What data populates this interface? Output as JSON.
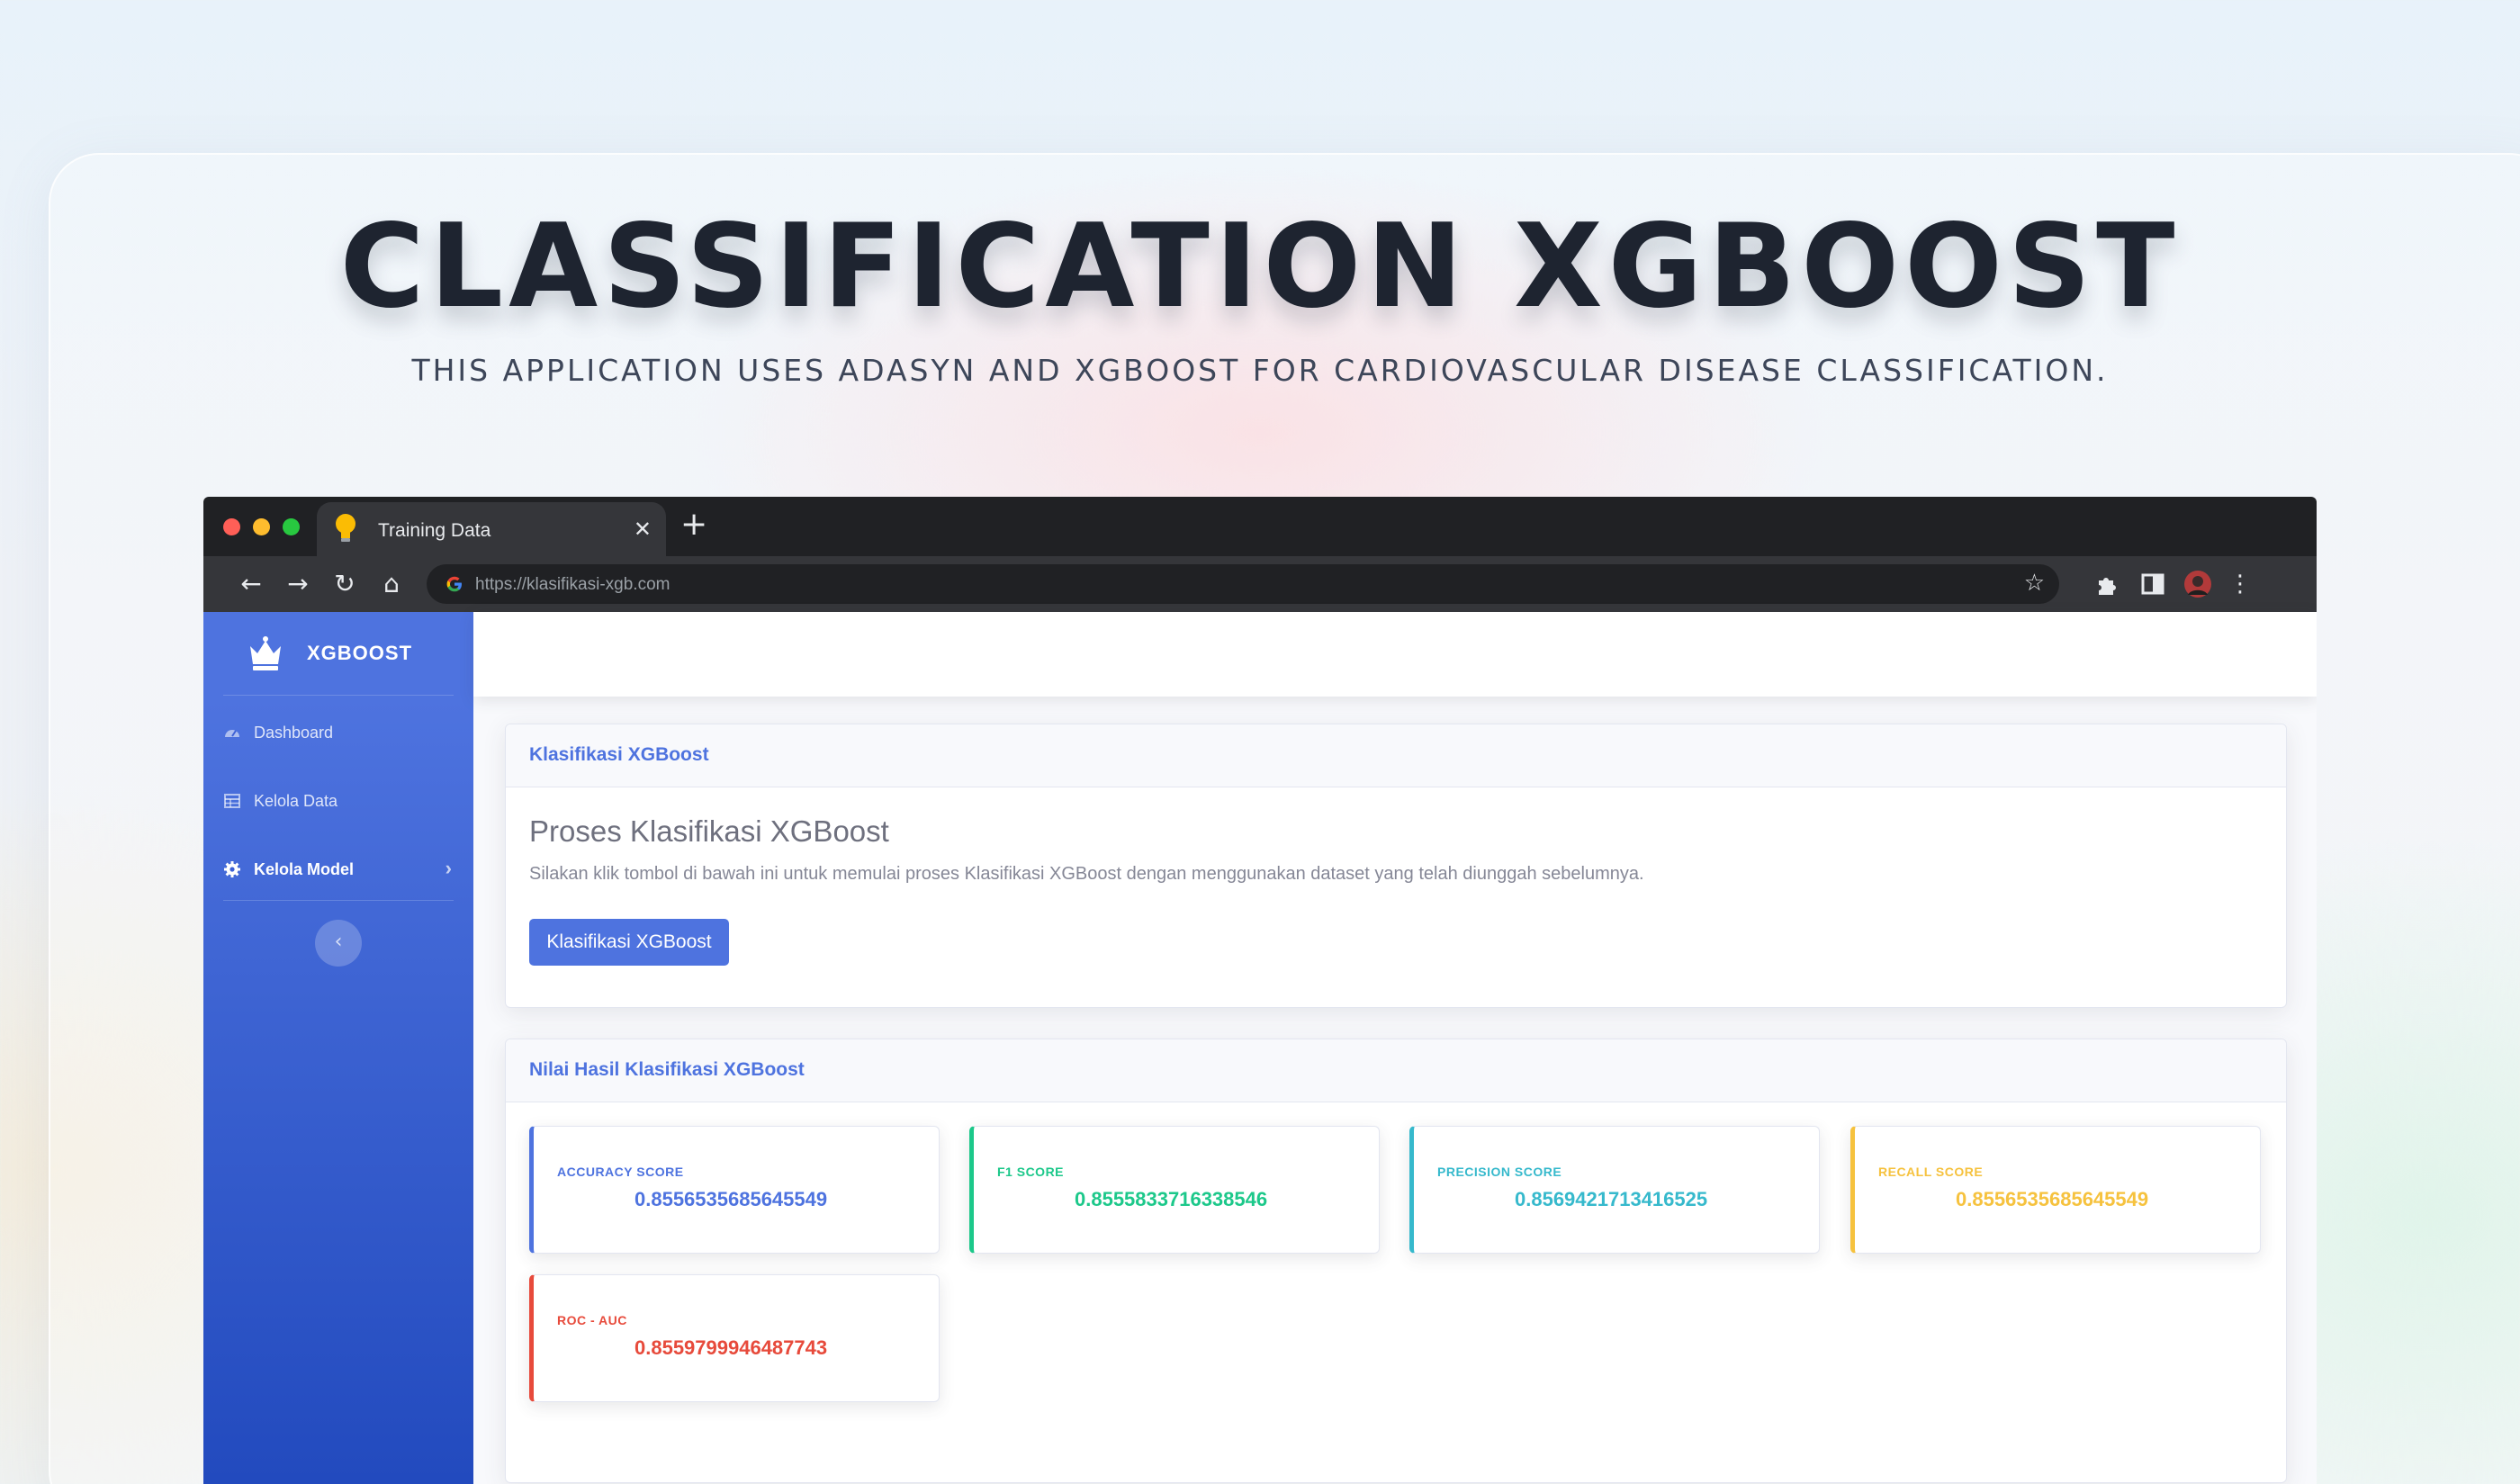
{
  "hero": {
    "title": "CLASSIFICATION XGBOOST",
    "subtitle": "THIS APPLICATION USES ADASYN AND XGBOOST FOR CARDIOVASCULAR DISEASE CLASSIFICATION."
  },
  "browser": {
    "tab_title": "Training Data",
    "url": "https://klasifikasi-xgb.com",
    "icons": [
      "back-icon",
      "forward-icon",
      "reload-icon",
      "home-icon",
      "google-icon",
      "bookmark-star-icon",
      "extensions-icon",
      "side-panel-icon",
      "profile-avatar",
      "more-menu-icon"
    ]
  },
  "sidebar": {
    "brand": "XGBOOST",
    "items": [
      {
        "label": "Dashboard",
        "icon": "gauge-icon"
      },
      {
        "label": "Kelola Data",
        "icon": "table-icon"
      },
      {
        "label": "Kelola Model",
        "icon": "gear-icon",
        "active": true
      }
    ],
    "toggle_symbol": "‹"
  },
  "process_card": {
    "header": "Klasifikasi XGBoost",
    "title": "Proses Klasifikasi XGBoost",
    "description": "Silakan klik tombol di bawah ini untuk memulai proses Klasifikasi XGBoost dengan menggunakan dataset yang telah diunggah sebelumnya.",
    "button": "Klasifikasi XGBoost"
  },
  "results_card": {
    "header": "Nilai Hasil Klasifikasi XGBoost",
    "metrics": [
      {
        "label": "ACCURACY SCORE",
        "value": "0.8556535685645549",
        "color": "#4e73df"
      },
      {
        "label": "F1 SCORE",
        "value": "0.8555833716338546",
        "color": "#1cc88a"
      },
      {
        "label": "PRECISION SCORE",
        "value": "0.8569421713416525",
        "color": "#36b9cc"
      },
      {
        "label": "RECALL SCORE",
        "value": "0.8556535685645549",
        "color": "#f6c23e"
      },
      {
        "label": "ROC - AUC",
        "value": "0.8559799946487743",
        "color": "#e74a3b"
      }
    ]
  },
  "colors": {
    "primary": "#4e73df",
    "sidebar_bottom": "#224abe",
    "browser_frame": "#202124"
  }
}
